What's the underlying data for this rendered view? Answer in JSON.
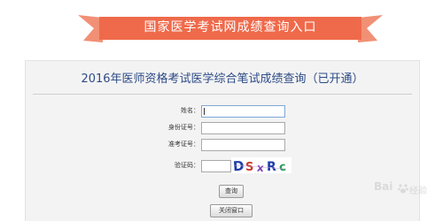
{
  "banner": {
    "title": "国家医学考试网成绩查询入口",
    "color": "#ef6a4b"
  },
  "panel": {
    "title": "2016年医师资格考试医学综合笔试成绩查询（已开通）",
    "title_color": "#2d4b86"
  },
  "form": {
    "name_label": "姓名：",
    "id_label": "身份证号：",
    "exam_no_label": "准考证号：",
    "captcha_label": "验证码：",
    "captcha_text": "DSxRc",
    "query_button": "查询",
    "close_button": "关闭窗口"
  },
  "watermark": {
    "brand": "Bai",
    "suffix": "经验"
  }
}
